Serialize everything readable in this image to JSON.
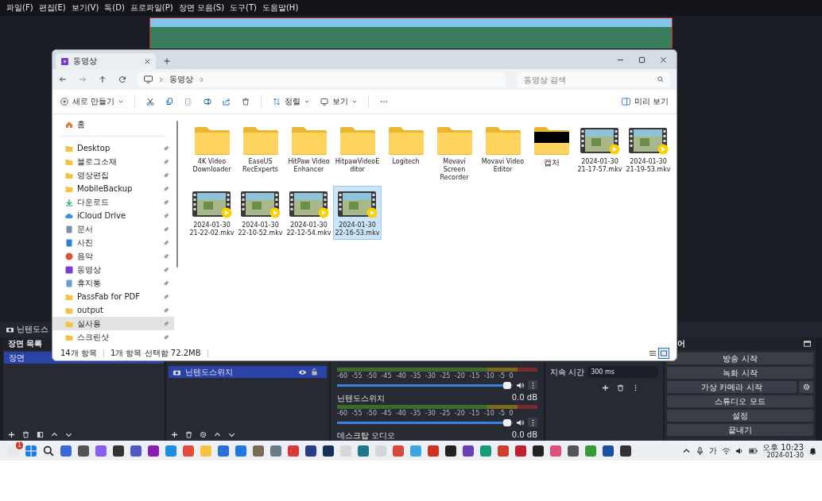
{
  "obs": {
    "menu": [
      "파일(F)",
      "편집(E)",
      "보기(V)",
      "독(D)",
      "프로파일(P)",
      "장면 모음(S)",
      "도구(T)",
      "도움말(H)"
    ],
    "scene_title": "닌텐도스",
    "scenes": {
      "title": "장면 목록",
      "items": [
        {
          "name": "장면",
          "selected": true
        }
      ]
    },
    "sources": {
      "items": [
        {
          "name": "닌텐도스위치",
          "selected": true,
          "visible": true
        }
      ]
    },
    "mixer": {
      "tracks": [
        {
          "ticks": [
            "-60",
            "-55",
            "-50",
            "-45",
            "-40",
            "-35",
            "-30",
            "-25",
            "-20",
            "-15",
            "-10",
            "-5",
            "0"
          ],
          "level": 0.97
        },
        {
          "name": "닌텐도스위치",
          "reading": "0.0 dB",
          "ticks": [
            "-60",
            "-55",
            "-50",
            "-45",
            "-40",
            "-35",
            "-30",
            "-25",
            "-20",
            "-15",
            "-10",
            "-5",
            "0"
          ],
          "level": 0.97
        },
        {
          "name": "데스크탑 오디오",
          "reading": "0.0 dB"
        }
      ]
    },
    "transitions": {
      "duration_label": "지속 시간",
      "duration": "300 ms"
    },
    "controls": {
      "title": "어",
      "buttons": [
        {
          "label": "방송 시작",
          "kind": "plain"
        },
        {
          "label": "녹화 시작",
          "kind": "plain"
        },
        {
          "label": "가상 카메라 시작",
          "kind": "gear"
        },
        {
          "label": "스튜디오 모드",
          "kind": "plain"
        },
        {
          "label": "설정",
          "kind": "plain"
        },
        {
          "label": "끝내기",
          "kind": "plain"
        }
      ]
    }
  },
  "explorer": {
    "tab": "동영상",
    "path": [
      "동영상"
    ],
    "search_placeholder": "동영상 검색",
    "toolbar": {
      "new": "새로 만들기",
      "sort": "정렬",
      "view": "보기",
      "preview": "미리 보기"
    },
    "sidebar": {
      "home": "홈",
      "items": [
        {
          "name": "Desktop",
          "kind": "folder",
          "pinned": true,
          "selected": false
        },
        {
          "name": "블로그소재",
          "kind": "folder",
          "pinned": true,
          "selected": false
        },
        {
          "name": "영상편집",
          "kind": "folder",
          "pinned": true,
          "selected": false
        },
        {
          "name": "MobileBackup",
          "kind": "folder",
          "pinned": true,
          "selected": false
        },
        {
          "name": "다운로드",
          "kind": "download",
          "pinned": true,
          "selected": false
        },
        {
          "name": "iCloud Drive",
          "kind": "cloud",
          "pinned": true,
          "selected": false
        },
        {
          "name": "문서",
          "kind": "document",
          "pinned": true,
          "selected": false
        },
        {
          "name": "사진",
          "kind": "pictures",
          "pinned": true,
          "selected": false
        },
        {
          "name": "음악",
          "kind": "music",
          "pinned": true,
          "selected": false
        },
        {
          "name": "동영상",
          "kind": "videos",
          "pinned": true,
          "selected": false
        },
        {
          "name": "휴지통",
          "kind": "recycle",
          "pinned": true,
          "selected": false
        },
        {
          "name": "PassFab for PDF",
          "kind": "folder",
          "pinned": true,
          "selected": false
        },
        {
          "name": "output",
          "kind": "folder",
          "pinned": true,
          "selected": false
        },
        {
          "name": "실사용",
          "kind": "folder",
          "pinned": true,
          "selected": true
        },
        {
          "name": "스크린샷",
          "kind": "folder",
          "pinned": true,
          "selected": false
        }
      ]
    },
    "files": [
      {
        "name": "4K Video Downloader",
        "kind": "folder",
        "selected": false
      },
      {
        "name": "EaseUS RecExperts",
        "kind": "folder",
        "selected": false
      },
      {
        "name": "HitPaw Video Enhancer",
        "kind": "folder",
        "selected": false
      },
      {
        "name": "HitpawVideoEditor",
        "kind": "folder",
        "selected": false
      },
      {
        "name": "Logitech",
        "kind": "folder",
        "selected": false
      },
      {
        "name": "Movavi Screen Recorder",
        "kind": "folder",
        "selected": false
      },
      {
        "name": "Movavi Video Editor",
        "kind": "folder",
        "selected": false
      },
      {
        "name": "캡처",
        "kind": "covered",
        "selected": false
      },
      {
        "name": "2024-01-30 21-17-57.mkv",
        "kind": "video",
        "selected": false
      },
      {
        "name": "2024-01-30 21-19-53.mkv",
        "kind": "video",
        "selected": false
      },
      {
        "name": "2024-01-30 21-22-02.mkv",
        "kind": "video",
        "selected": false
      },
      {
        "name": "2024-01-30 22-10-52.mkv",
        "kind": "video",
        "selected": false
      },
      {
        "name": "2024-01-30 22-12-54.mkv",
        "kind": "video",
        "selected": false
      },
      {
        "name": "2024-01-30 22-16-53.mkv",
        "kind": "video",
        "selected": true
      }
    ],
    "status": {
      "count": "14개 항목",
      "selection": "1개 항목 선택함 72.2MB"
    },
    "views": [
      {
        "kind": "details",
        "selected": false
      },
      {
        "kind": "tiles",
        "selected": true
      }
    ]
  },
  "taskbar": {
    "badge": "1",
    "ime": "가",
    "time": "오후 10:23",
    "date": "2024-01-30"
  }
}
